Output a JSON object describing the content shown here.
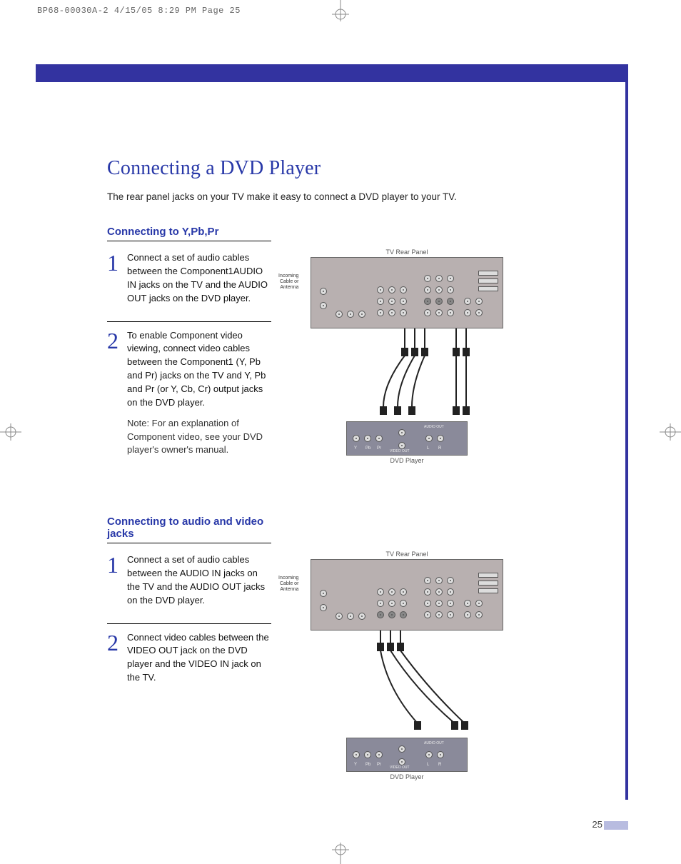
{
  "print_header": "BP68-00030A-2  4/15/05  8:29 PM  Page 25",
  "title": "Connecting a DVD Player",
  "intro": "The rear panel jacks on your TV make it easy to connect a DVD player to your TV.",
  "section1": {
    "heading": "Connecting to Y,Pb,Pr",
    "step1_num": "1",
    "step1_text": "Connect a set of audio cables between the Component1AUDIO IN jacks on the TV and the AUDIO OUT jacks on the DVD player.",
    "step2_num": "2",
    "step2_text": "To enable Component video viewing, connect video cables between the Component1 (Y, Pb and Pr) jacks on the TV and Y, Pb and Pr (or Y, Cb, Cr) output jacks on the DVD player.",
    "step2_note": "Note: For an explanation of Component video, see your DVD player's owner's manual."
  },
  "section2": {
    "heading": "Connecting to audio and video jacks",
    "step1_num": "1",
    "step1_text": "Connect a set of audio cables between the AUDIO IN jacks on the TV and the AUDIO OUT jacks on the DVD player.",
    "step2_num": "2",
    "step2_text": "Connect video cables between the VIDEO OUT jack on the DVD player and the VIDEO IN jack on the TV."
  },
  "diagram": {
    "tv_label": "TV Rear Panel",
    "dvd_label": "DVD Player",
    "antenna_label": "Incoming\nCable or\nAntenna",
    "dvd_jacks": {
      "y": "Y",
      "pb": "Pb",
      "pr": "Pr",
      "video": "VIDEO OUT",
      "audio": "AUDIO OUT",
      "l": "L",
      "r": "R"
    }
  },
  "page_number": "25"
}
